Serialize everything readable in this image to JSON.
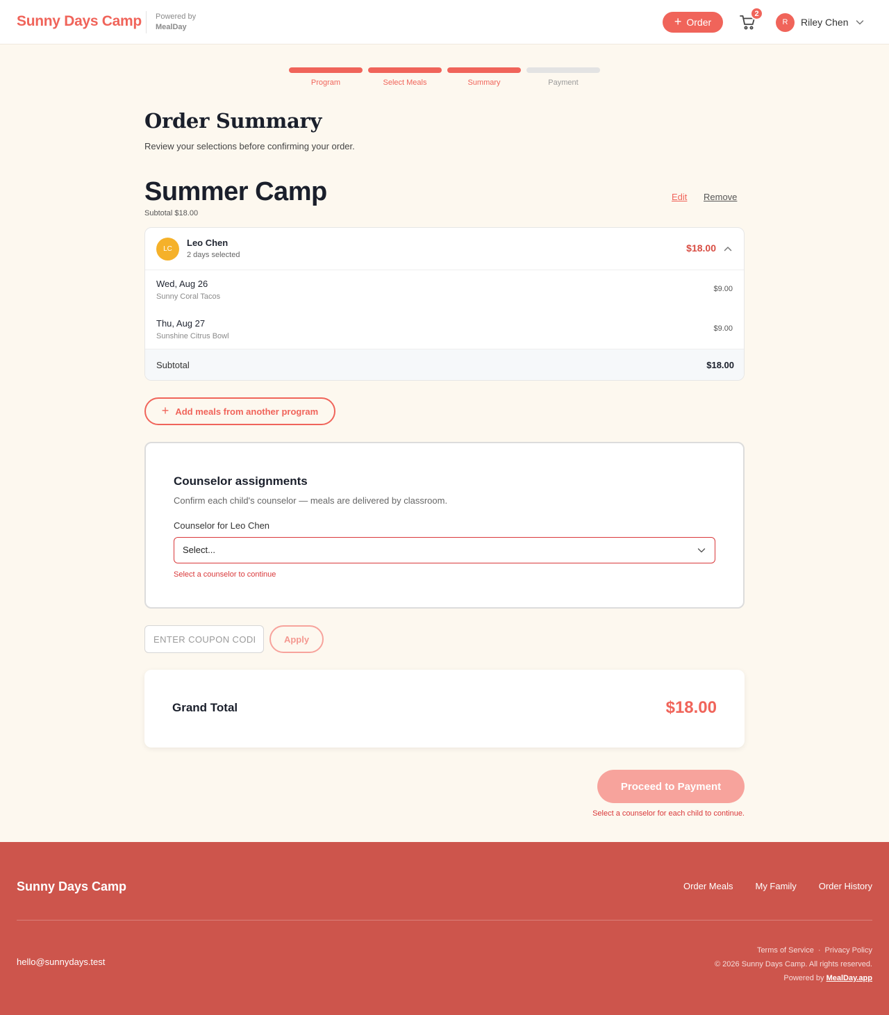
{
  "header": {
    "brand": "Sunny Days Camp",
    "powered_by_label": "Powered by",
    "powered_by_name": "MealDay",
    "order_button": "Order",
    "cart_count": "2",
    "user_initial": "R",
    "user_name": "Riley Chen"
  },
  "steps": [
    {
      "label": "Program",
      "complete": true
    },
    {
      "label": "Select Meals",
      "complete": true
    },
    {
      "label": "Summary",
      "complete": true
    },
    {
      "label": "Payment",
      "complete": false
    }
  ],
  "page": {
    "title": "Order Summary",
    "subtitle": "Review your selections before confirming your order."
  },
  "program": {
    "title": "Summer Camp",
    "subtotal_text": "Subtotal $18.00",
    "edit_label": "Edit",
    "remove_label": "Remove",
    "child": {
      "initials": "LC",
      "name": "Leo Chen",
      "days_selected": "2 days selected",
      "total": "$18.00",
      "meals": [
        {
          "date": "Wed, Aug 26",
          "meal": "Sunny Coral Tacos",
          "price": "$9.00"
        },
        {
          "date": "Thu, Aug 27",
          "meal": "Sunshine Citrus Bowl",
          "price": "$9.00"
        }
      ],
      "subtotal_label": "Subtotal",
      "subtotal_value": "$18.00"
    }
  },
  "add_program_button": "Add meals from another program",
  "counselor": {
    "title": "Counselor assignments",
    "description": "Confirm each child's counselor — meals are delivered by classroom.",
    "field_label": "Counselor for Leo Chen",
    "selected": "Select...",
    "error": "Select a counselor to continue"
  },
  "coupon": {
    "placeholder": "ENTER COUPON CODE",
    "apply_label": "Apply"
  },
  "grand_total": {
    "label": "Grand Total",
    "value": "$18.00"
  },
  "proceed": {
    "label": "Proceed to Payment",
    "error": "Select a counselor for each child to continue."
  },
  "footer": {
    "brand": "Sunny Days Camp",
    "links": [
      "Order Meals",
      "My Family",
      "Order History"
    ],
    "email": "hello@sunnydays.test",
    "terms": "Terms of Service",
    "separator": "·",
    "privacy": "Privacy Policy",
    "copyright": "© 2026 Sunny Days Camp. All rights reserved.",
    "powered_by_label": "Powered by",
    "powered_by_link": "MealDay.app"
  },
  "colors": {
    "accent": "#f0645a",
    "accent_muted": "#f7a39c",
    "error": "#d9383a",
    "footer_bg": "#cd554c",
    "page_bg": "#fdf8ef",
    "child_avatar": "#f5b12a"
  },
  "icons": [
    "plus-icon",
    "cart-icon",
    "chevron-down-icon",
    "chevron-up-icon"
  ]
}
